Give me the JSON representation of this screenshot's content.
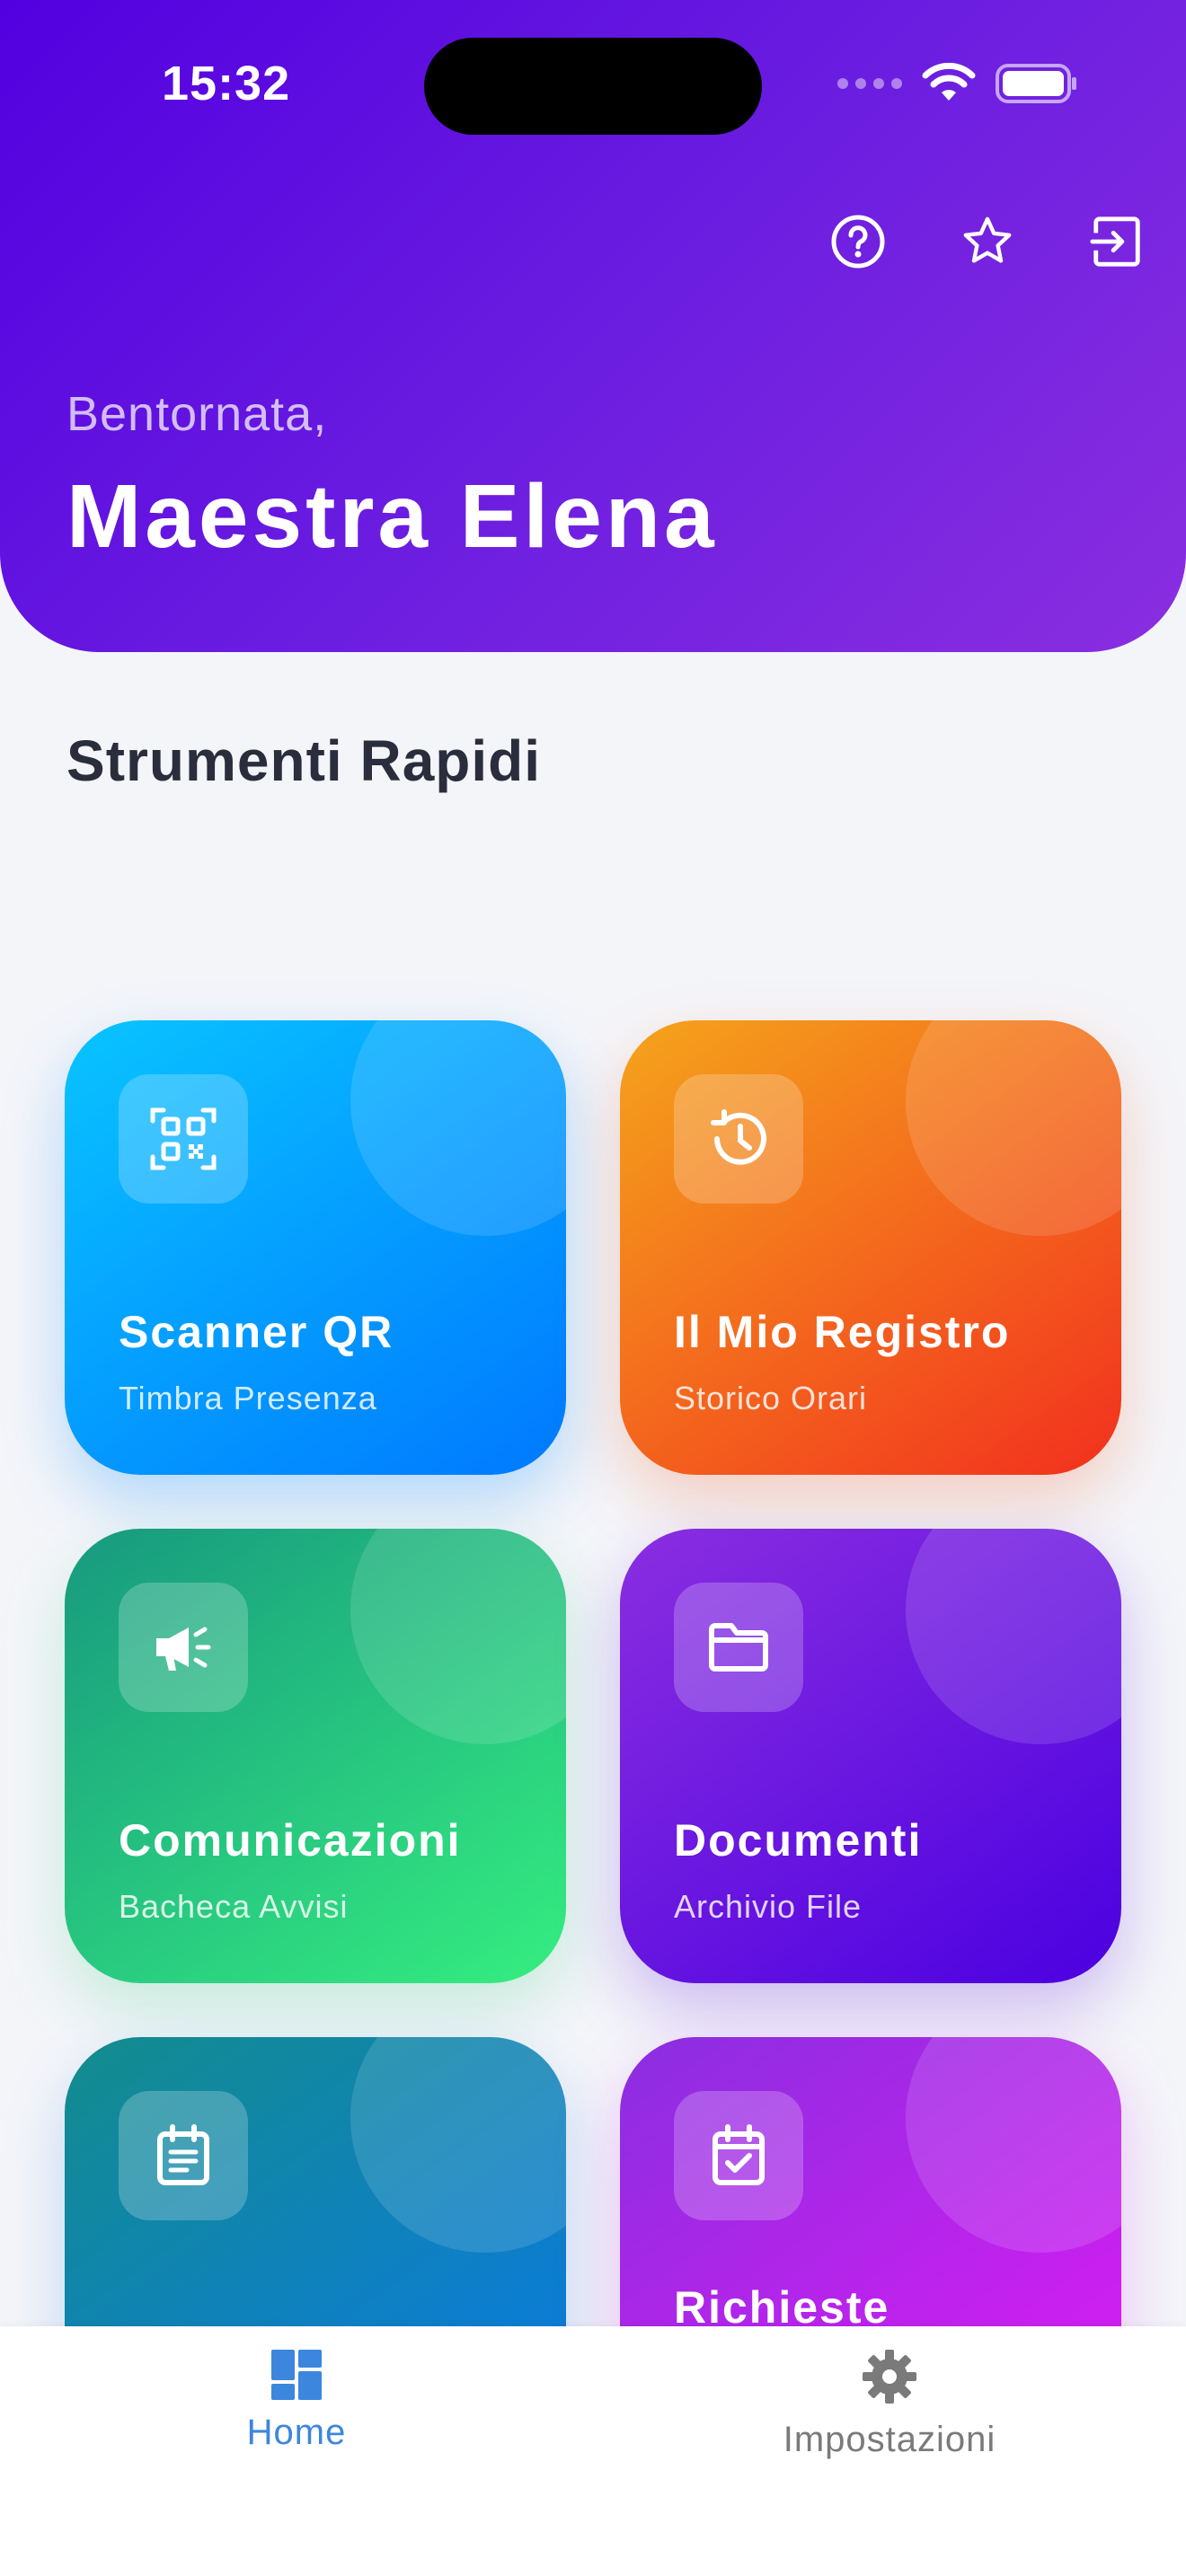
{
  "status_bar": {
    "time": "15:32"
  },
  "header": {
    "greeting": "Bentornata,",
    "user_name": "Maestra Elena",
    "actions": [
      {
        "icon": "help-circle-icon"
      },
      {
        "icon": "star-icon"
      },
      {
        "icon": "logout-icon"
      }
    ]
  },
  "section_title": "Strumenti Rapidi",
  "cards": [
    {
      "title": "Scanner QR",
      "subtitle": "Timbra Presenza",
      "icon": "qr-code-icon",
      "colors": [
        "#09c4ff",
        "#0078ff"
      ]
    },
    {
      "title": "Il Mio Registro",
      "subtitle": "Storico Orari",
      "icon": "history-clock-icon",
      "colors": [
        "#f5a41c",
        "#f2301e"
      ]
    },
    {
      "title": "Comunicazioni",
      "subtitle": "Bacheca Avvisi",
      "icon": "megaphone-icon",
      "colors": [
        "#17997f",
        "#35ee80"
      ]
    },
    {
      "title": "Documenti",
      "subtitle": "Archivio File",
      "icon": "folder-icon",
      "colors": [
        "#8a2ee0",
        "#4a00e0"
      ]
    },
    {
      "title": "",
      "subtitle": "",
      "icon": "article-calendar-icon",
      "colors": [
        "#138c8c",
        "#0a78e8"
      ]
    },
    {
      "title": "Richieste",
      "subtitle": "",
      "icon": "calendar-check-icon",
      "colors": [
        "#8a2ee0",
        "#e01bf5"
      ]
    }
  ],
  "tabbar": {
    "home_label": "Home",
    "settings_label": "Impostazioni",
    "active_color": "#3d86dd",
    "inactive_color": "#7a7a7a"
  }
}
